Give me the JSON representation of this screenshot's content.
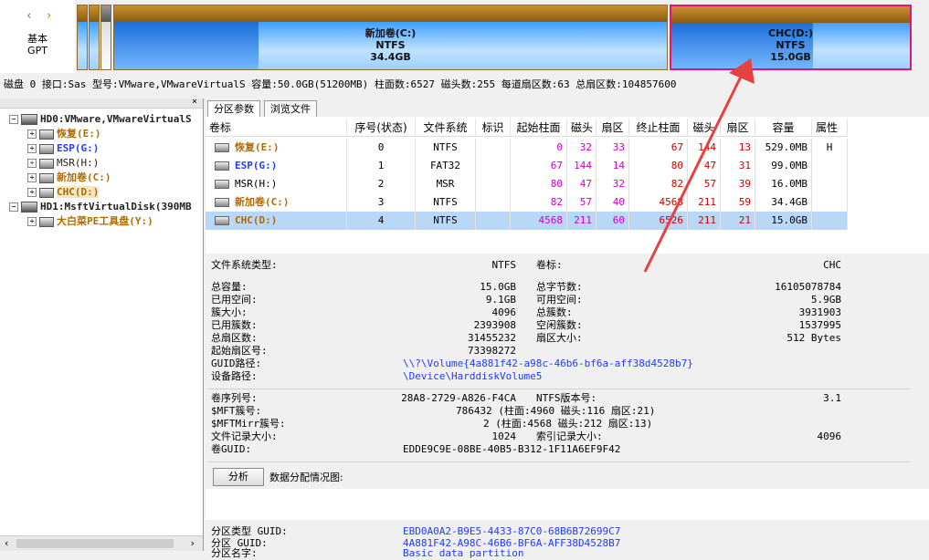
{
  "disk_bar": {
    "nav_left": "‹",
    "nav_right": "›",
    "type_line1": "基本",
    "type_line2": "GPT",
    "partitions": [
      {
        "label": "新加卷(C:)",
        "fs": "NTFS",
        "size": "34.4GB"
      },
      {
        "label": "CHC(D:)",
        "fs": "NTFS",
        "size": "15.0GB"
      }
    ]
  },
  "disk_info": "磁盘 0 接口:Sas  型号:VMware,VMwareVirtualS  容量:50.0GB(51200MB)  柱面数:6527  磁头数:255  每道扇区数:63  总扇区数:104857600",
  "tree": {
    "close": "×",
    "nodes": [
      {
        "text": "HD0:VMware,VMwareVirtualS",
        "expander": "−"
      },
      {
        "text": "恢复(E:)",
        "expander": "+"
      },
      {
        "text": "ESP(G:)",
        "expander": "+"
      },
      {
        "text": "MSR(H:)",
        "expander": "+"
      },
      {
        "text": "新加卷(C:)",
        "expander": "+"
      },
      {
        "text": "CHC(D:)",
        "expander": "+"
      },
      {
        "text": "HD1:MsftVirtualDisk(390MB",
        "expander": "−"
      },
      {
        "text": "大白菜PE工具盘(Y:)",
        "expander": "+"
      }
    ],
    "scroll_left": "‹",
    "scroll_right": "›"
  },
  "tabs": [
    "分区参数",
    "浏览文件"
  ],
  "table": {
    "headers": [
      "卷标",
      "序号(状态)",
      "文件系统",
      "标识",
      "起始柱面",
      "磁头",
      "扇区",
      "终止柱面",
      "磁头",
      "扇区",
      "容量",
      "属性"
    ],
    "rows": [
      [
        "恢复(E:)",
        "0",
        "NTFS",
        "",
        "0",
        "32",
        "33",
        "67",
        "144",
        "13",
        "529.0MB",
        "H"
      ],
      [
        "ESP(G:)",
        "1",
        "FAT32",
        "",
        "67",
        "144",
        "14",
        "80",
        "47",
        "31",
        "99.0MB",
        ""
      ],
      [
        "MSR(H:)",
        "2",
        "MSR",
        "",
        "80",
        "47",
        "32",
        "82",
        "57",
        "39",
        "16.0MB",
        ""
      ],
      [
        "新加卷(C:)",
        "3",
        "NTFS",
        "",
        "82",
        "57",
        "40",
        "4568",
        "211",
        "59",
        "34.4GB",
        ""
      ],
      [
        "CHC(D:)",
        "4",
        "NTFS",
        "",
        "4568",
        "211",
        "60",
        "6526",
        "211",
        "21",
        "15.0GB",
        ""
      ]
    ]
  },
  "details": {
    "fs_type_label": "文件系统类型:",
    "fs_type": "NTFS",
    "vol_label_label": "卷标:",
    "vol_label": "CHC",
    "left": [
      {
        "label": "总容量:",
        "value": "15.0GB"
      },
      {
        "label": "已用空间:",
        "value": "9.1GB"
      },
      {
        "label": "簇大小:",
        "value": "4096"
      },
      {
        "label": "已用簇数:",
        "value": "2393908"
      },
      {
        "label": "总扇区数:",
        "value": "31455232"
      },
      {
        "label": "起始扇区号:",
        "value": "73398272"
      }
    ],
    "right": [
      {
        "label": "总字节数:",
        "value": "16105078784"
      },
      {
        "label": "可用空间:",
        "value": "5.9GB"
      },
      {
        "label": "总簇数:",
        "value": "3931903"
      },
      {
        "label": "空闲簇数:",
        "value": "1537995"
      },
      {
        "label": "扇区大小:",
        "value": "512 Bytes"
      }
    ],
    "guid_path_label": "GUID路径:",
    "guid_path": "\\\\?\\Volume{4a881f42-a98c-46b6-bf6a-aff38d4528b7}",
    "device_path_label": "设备路径:",
    "device_path": "\\Device\\HarddiskVolume5",
    "serial_label": "卷序列号:",
    "serial": "28A8-2729-A826-F4CA",
    "ntfs_ver_label": "NTFS版本号:",
    "ntfs_ver": "3.1",
    "mft_label": "$MFT簇号:",
    "mft": "786432 (柱面:4960 磁头:116 扇区:21)",
    "mftmirr_label": "$MFTMirr簇号:",
    "mftmirr": "2 (柱面:4568 磁头:212 扇区:13)",
    "rec_size_label": "文件记录大小:",
    "rec_size": "1024",
    "idx_size_label": "索引记录大小:",
    "idx_size": "4096",
    "vol_guid_label": "卷GUID:",
    "vol_guid": "EDDE9C9E-08BE-40B5-B312-1F11A6EF9F42",
    "analyze_button": "分析",
    "alloc_label": "数据分配情况图:",
    "ptype_label": "分区类型 GUID:",
    "ptype": "EBD0A0A2-B9E5-4433-87C0-68B6B72699C7",
    "pguid_label": "分区 GUID:",
    "pguid": "4A881F42-A98C-46B6-BF6A-AFF38D4528B7",
    "pname_label": "分区名字:",
    "pname": "Basic data partition"
  },
  "colors": {
    "accent": "#e8136e",
    "selection": "#b9d7f7",
    "partition_blue": "#3fa0ff"
  }
}
